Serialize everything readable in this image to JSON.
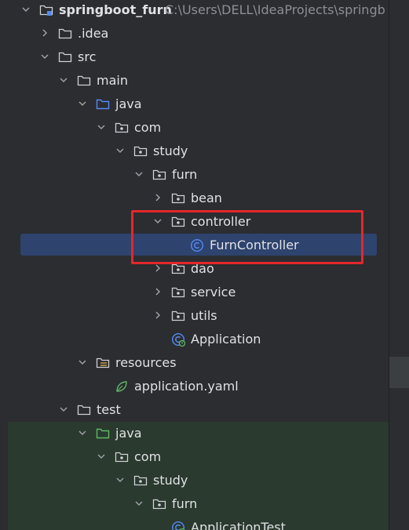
{
  "project_tree": {
    "root": {
      "name": "springboot_furn",
      "path": "C:\\Users\\DELL\\IdeaProjects\\springb"
    },
    "rows": [
      {
        "label": "springboot_furn",
        "icon": "module-folder-icon",
        "chevron": "down"
      },
      {
        "label": ".idea",
        "icon": "folder-icon",
        "chevron": "right"
      },
      {
        "label": "src",
        "icon": "folder-icon",
        "chevron": "down"
      },
      {
        "label": "main",
        "icon": "folder-icon",
        "chevron": "down"
      },
      {
        "label": "java",
        "icon": "source-root-folder-icon",
        "chevron": "down"
      },
      {
        "label": "com",
        "icon": "package-icon",
        "chevron": "down"
      },
      {
        "label": "study",
        "icon": "package-icon",
        "chevron": "down"
      },
      {
        "label": "furn",
        "icon": "package-icon",
        "chevron": "down"
      },
      {
        "label": "bean",
        "icon": "package-icon",
        "chevron": "right"
      },
      {
        "label": "controller",
        "icon": "package-icon",
        "chevron": "down"
      },
      {
        "label": "FurnController",
        "icon": "class-icon",
        "chevron": "none",
        "selected": true
      },
      {
        "label": "dao",
        "icon": "package-icon",
        "chevron": "right"
      },
      {
        "label": "service",
        "icon": "package-icon",
        "chevron": "right"
      },
      {
        "label": "utils",
        "icon": "package-icon",
        "chevron": "right"
      },
      {
        "label": "Application",
        "icon": "spring-boot-class-icon",
        "chevron": "none"
      },
      {
        "label": "resources",
        "icon": "resources-folder-icon",
        "chevron": "down"
      },
      {
        "label": "application.yaml",
        "icon": "spring-yaml-icon",
        "chevron": "none"
      },
      {
        "label": "test",
        "icon": "folder-icon",
        "chevron": "down"
      },
      {
        "label": "java",
        "icon": "test-source-root-folder-icon",
        "chevron": "down"
      },
      {
        "label": "com",
        "icon": "package-icon",
        "chevron": "down"
      },
      {
        "label": "study",
        "icon": "package-icon",
        "chevron": "down"
      },
      {
        "label": "furn",
        "icon": "package-icon",
        "chevron": "down"
      },
      {
        "label": "ApplicationTest",
        "icon": "spring-boot-class-icon",
        "chevron": "none"
      }
    ]
  },
  "colors": {
    "background": "#2b2d30",
    "selection": "#2e436e",
    "test_background": "#2a3a2e",
    "highlight_box": "#e4272b",
    "source_root": "#548af7",
    "test_root": "#5fb865",
    "class_icon": "#548af7"
  }
}
